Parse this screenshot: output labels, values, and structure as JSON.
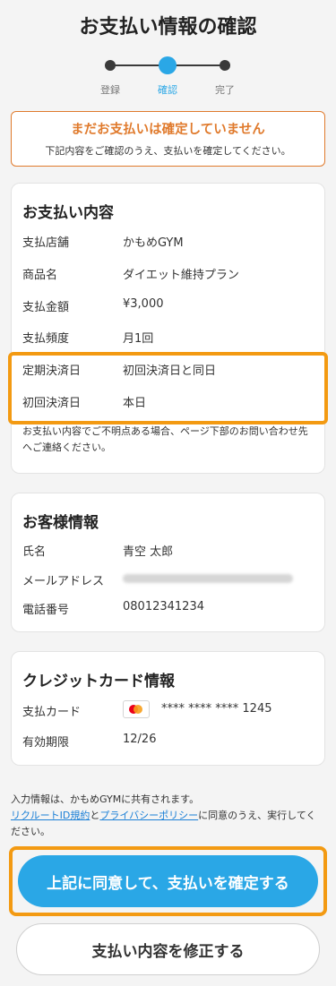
{
  "page": {
    "title": "お支払い情報の確認"
  },
  "stepper": {
    "steps": [
      "登録",
      "確認",
      "完了"
    ],
    "active_index": 1
  },
  "warning": {
    "title": "まだお支払いは確定していません",
    "subtitle": "下記内容をご確認のうえ、支払いを確定してください。"
  },
  "payment_details": {
    "heading": "お支払い内容",
    "rows": [
      {
        "label": "支払店舗",
        "value": "かもめGYM"
      },
      {
        "label": "商品名",
        "value": "ダイエット維持プラン"
      },
      {
        "label": "支払金額",
        "value": "¥3,000"
      },
      {
        "label": "支払頻度",
        "value": "月1回"
      },
      {
        "label": "定期決済日",
        "value": "初回決済日と同日"
      },
      {
        "label": "初回決済日",
        "value": "本日"
      }
    ],
    "note": "お支払い内容でご不明点ある場合、ページ下部のお問い合わせ先へご連絡ください。"
  },
  "customer": {
    "heading": "お客様情報",
    "name_label": "氏名",
    "name_value": "青空 太郎",
    "email_label": "メールアドレス",
    "phone_label": "電話番号",
    "phone_value": "08012341234"
  },
  "credit_card": {
    "heading": "クレジットカード情報",
    "card_label": "支払カード",
    "card_number": "**** **** **** 1245",
    "card_icon": "mastercard-icon",
    "expiry_label": "有効期限",
    "expiry_value": "12/26"
  },
  "consent": {
    "line1": "入力情報は、かもめGYMに共有されます。",
    "link1": "リクルートID規約",
    "and": "と",
    "link2": "プライバシーポリシー",
    "suffix": "に同意のうえ、実行してください。"
  },
  "buttons": {
    "confirm": "上記に同意して、支払いを確定する",
    "edit": "支払い内容を修正する"
  },
  "colors": {
    "accent": "#2aa7e6",
    "warning": "#e07a2c",
    "highlight": "#f39a12"
  }
}
